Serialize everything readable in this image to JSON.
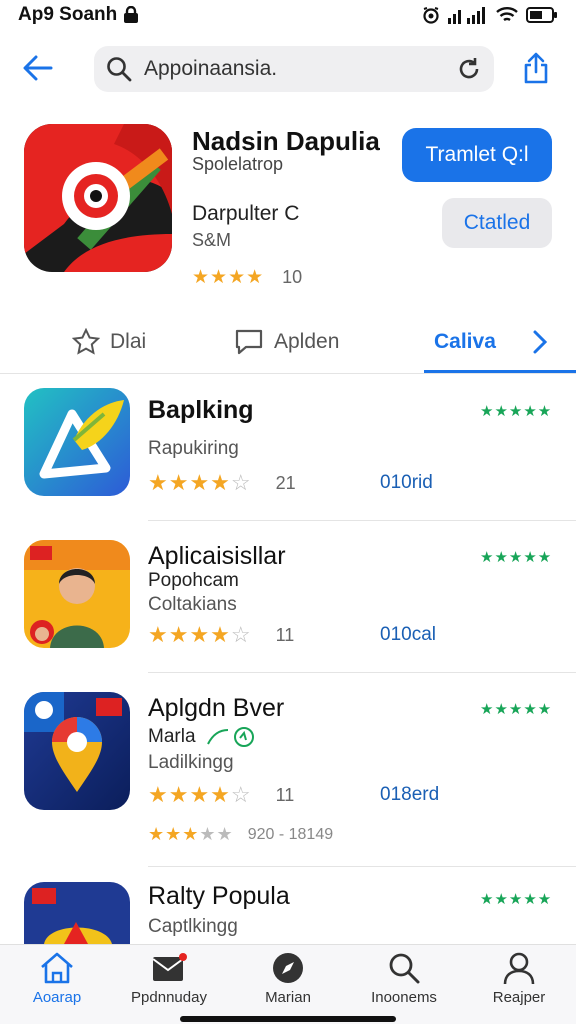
{
  "status": {
    "title": "Ap9 Soanh",
    "icons": [
      "lock-icon",
      "alarm-icon",
      "signal-icon",
      "wifi-icon",
      "battery-icon"
    ]
  },
  "search": {
    "value": "Appoinaansia."
  },
  "feature": {
    "name": "Nadsin Dapulia",
    "developer": "Spolelatrop",
    "subtitle": "Darpulter C",
    "size": "S&M",
    "rating_count": "10",
    "rating": 3.5,
    "primary_button": "Tramlet Q:l",
    "secondary_button": "Ctatled"
  },
  "tabs": [
    {
      "label": "Dlai",
      "icon": "star-outline-icon"
    },
    {
      "label": "Aplden",
      "icon": "chat-bubble-icon"
    },
    {
      "label": "Caliva",
      "active": true
    }
  ],
  "apps": [
    {
      "title": "Baplking",
      "line1": "Rapukiring",
      "line2": "",
      "count": "21",
      "size": "010rid",
      "rating": 4
    },
    {
      "title": "Aplicaisisllar",
      "line1": "Popohcam",
      "line2": "Coltakians",
      "count": "11",
      "size": "010cal",
      "rating": 4
    },
    {
      "title": "Aplgdn Bver",
      "line1": "Marla",
      "line2": "Ladilkingg",
      "count": "11",
      "size": "018erd",
      "rating": 4,
      "extra": "920 - 18149"
    },
    {
      "title": "Ralty Popula",
      "line1": "Captlkingg",
      "line2": "",
      "count": "",
      "size": "",
      "rating": 0
    }
  ],
  "nav": [
    {
      "label": "Aoarap",
      "icon": "home-icon",
      "active": true
    },
    {
      "label": "Ppdnnuday",
      "icon": "mail-icon"
    },
    {
      "label": "Marian",
      "icon": "compass-icon"
    },
    {
      "label": "Inoonems",
      "icon": "search-icon"
    },
    {
      "label": "Reajper",
      "icon": "person-icon"
    }
  ],
  "colors": {
    "accent": "#1a73e8",
    "star": "#f4a623",
    "green": "#18a558"
  }
}
